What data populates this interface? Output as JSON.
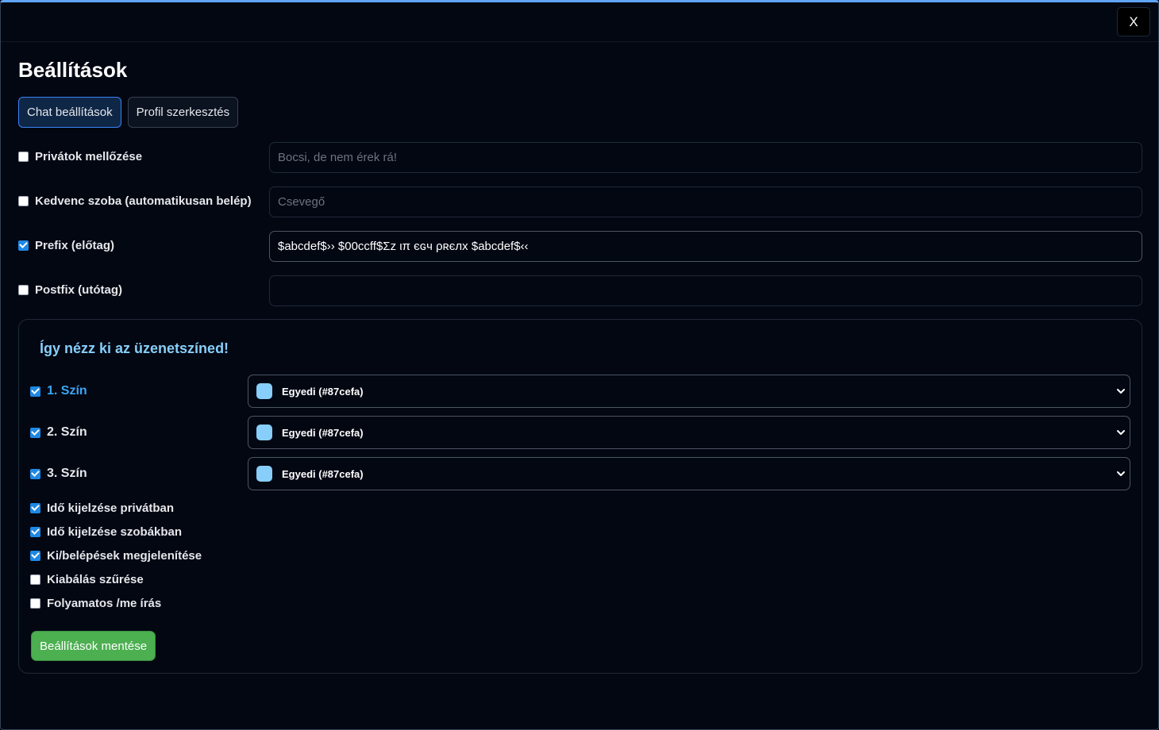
{
  "window": {
    "title": "Beállítások",
    "close_label": "X"
  },
  "tabs": [
    {
      "label": "Chat beállítások",
      "active": true
    },
    {
      "label": "Profil szerkesztés",
      "active": false
    }
  ],
  "form": {
    "rows": [
      {
        "label": "Privátok mellőzése",
        "checked": false,
        "value": "",
        "placeholder": "Bocsi, de nem érek rá!"
      },
      {
        "label": "Kedvenc szoba (automatikusan belép)",
        "checked": false,
        "value": "",
        "placeholder": "Csevegő"
      },
      {
        "label": "Prefix (előtag)",
        "checked": true,
        "value": "$abcdef$›› $00ccff$Σz ιπ єɢч ρʀєлx $abcdef$‹‹",
        "placeholder": ""
      },
      {
        "label": "Postfix (utótag)",
        "checked": false,
        "value": "",
        "placeholder": ""
      }
    ]
  },
  "panel": {
    "title": "Így nézz ki az üzenetszíned!",
    "colors": [
      {
        "label": "1. Szín",
        "checked": true,
        "selected": "Egyedi (#87cefa)",
        "swatch": "#87cefa"
      },
      {
        "label": "2. Szín",
        "checked": true,
        "selected": "Egyedi (#87cefa)",
        "swatch": "#87cefa"
      },
      {
        "label": "3. Szín",
        "checked": true,
        "selected": "Egyedi (#87cefa)",
        "swatch": "#87cefa"
      }
    ],
    "options": [
      {
        "label": "Idő kijelzése privátban",
        "checked": true
      },
      {
        "label": "Idő kijelzése szobákban",
        "checked": true
      },
      {
        "label": "Ki/belépések megjelenítése",
        "checked": true
      },
      {
        "label": "Kiabálás szűrése",
        "checked": false
      },
      {
        "label": "Folyamatos /me írás",
        "checked": false
      }
    ],
    "save_label": "Beállítások mentése"
  },
  "colors": {
    "accent": "#87cefa",
    "save": "#4caf50",
    "checkbox": "#1e88e5"
  }
}
